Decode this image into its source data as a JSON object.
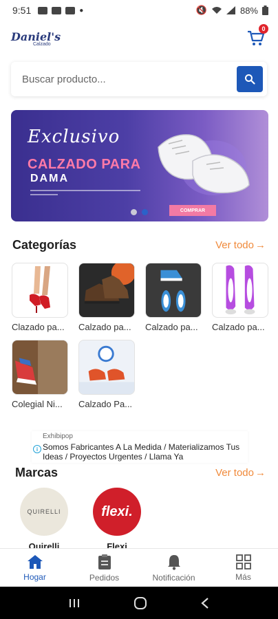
{
  "status_bar": {
    "time": "9:51",
    "battery": "88%"
  },
  "header": {
    "logo_main": "Daniel's",
    "logo_sub": "Calzado",
    "cart_count": "0"
  },
  "search": {
    "placeholder": "Buscar producto..."
  },
  "banner": {
    "line1": "Exclusivo",
    "line2": "CALZADO PARA",
    "line3": "DAMA",
    "button": "COMPRAR",
    "slide_count": 2,
    "active_slide": 1
  },
  "categories": {
    "title": "Categorías",
    "see_all": "Ver todo",
    "items": [
      {
        "label": "Clazado pa..."
      },
      {
        "label": "Calzado pa..."
      },
      {
        "label": "Calzado pa..."
      },
      {
        "label": "Calzado pa..."
      },
      {
        "label": "Colegial Ni..."
      },
      {
        "label": "Calzado Pa..."
      }
    ]
  },
  "ad": {
    "source": "Exhibipop",
    "text": "Somos Fabricantes A La Medida / Materializamos Tus Ideas / Proyectos Urgentes / Llama Ya"
  },
  "brands": {
    "title": "Marcas",
    "see_all": "Ver todo",
    "items": [
      {
        "name": "Quirelli",
        "logo_text": "QUIRELLI"
      },
      {
        "name": "Flexi",
        "logo_text": "flexi."
      }
    ]
  },
  "bottom_nav": {
    "items": [
      {
        "label": "Hogar",
        "icon": "home-icon",
        "active": true
      },
      {
        "label": "Pedidos",
        "icon": "clipboard-icon",
        "active": false
      },
      {
        "label": "Notificación",
        "icon": "bell-icon",
        "active": false
      },
      {
        "label": "Más",
        "icon": "grid-icon",
        "active": false
      }
    ]
  },
  "colors": {
    "accent": "#1d58b8",
    "link": "#f08a3b",
    "badge": "#e0242c"
  }
}
